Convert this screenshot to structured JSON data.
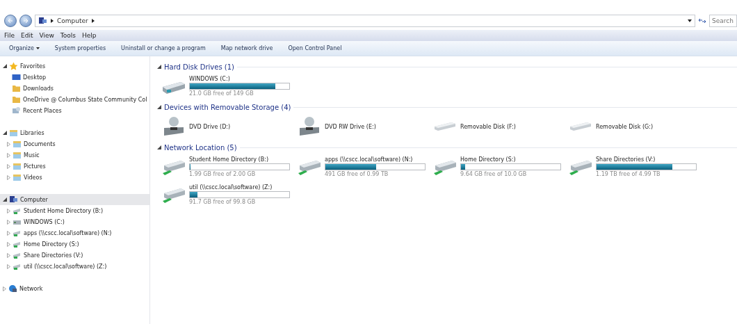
{
  "address": {
    "path": "Computer",
    "search_placeholder": "Search"
  },
  "menu": [
    "File",
    "Edit",
    "View",
    "Tools",
    "Help"
  ],
  "toolbar": [
    {
      "label": "Organize",
      "dropdown": true
    },
    {
      "label": "System properties",
      "dropdown": false
    },
    {
      "label": "Uninstall or change a program",
      "dropdown": false
    },
    {
      "label": "Map network drive",
      "dropdown": false
    },
    {
      "label": "Open Control Panel",
      "dropdown": false
    }
  ],
  "sidebar": {
    "groups": [
      {
        "label": "Favorites",
        "kind": "star",
        "expanded": true,
        "selected": false,
        "children": [
          {
            "label": "Desktop",
            "kind": "desktop"
          },
          {
            "label": "Downloads",
            "kind": "folder"
          },
          {
            "label": "OneDrive @ Columbus State Community Col",
            "kind": "folder"
          },
          {
            "label": "Recent Places",
            "kind": "recent"
          }
        ]
      },
      {
        "label": "Libraries",
        "kind": "library",
        "expanded": true,
        "selected": false,
        "children": [
          {
            "label": "Documents",
            "kind": "library",
            "expanded": false
          },
          {
            "label": "Music",
            "kind": "library",
            "expanded": false
          },
          {
            "label": "Pictures",
            "kind": "library",
            "expanded": false
          },
          {
            "label": "Videos",
            "kind": "library",
            "expanded": false
          }
        ]
      },
      {
        "label": "Computer",
        "kind": "computer",
        "expanded": true,
        "selected": true,
        "children": [
          {
            "label": "Student Home Directory (B:)",
            "kind": "network",
            "expanded": false
          },
          {
            "label": "WINDOWS (C:)",
            "kind": "hdd",
            "expanded": false
          },
          {
            "label": "apps (\\\\cscc.local\\software) (N:)",
            "kind": "network",
            "expanded": false
          },
          {
            "label": "Home Directory (S:)",
            "kind": "network",
            "expanded": false
          },
          {
            "label": "Share Directories (V:)",
            "kind": "network",
            "expanded": false
          },
          {
            "label": "util (\\\\cscc.local\\software) (Z:)",
            "kind": "network",
            "expanded": false
          }
        ]
      },
      {
        "label": "Network",
        "kind": "network-globe",
        "expanded": false,
        "selected": false
      }
    ]
  },
  "sections": [
    {
      "title": "Hard Disk Drives (1)",
      "expanded": true,
      "drives": [
        {
          "name": "WINDOWS (C:)",
          "kind": "hdd",
          "level": 0.86,
          "free": "21.0 GB free of 149 GB"
        }
      ]
    },
    {
      "title": "Devices with Removable Storage (4)",
      "expanded": true,
      "drives": [
        {
          "name": "DVD Drive (D:)",
          "kind": "dvd"
        },
        {
          "name": "DVD RW Drive (E:)",
          "kind": "dvd"
        },
        {
          "name": "Removable Disk (F:)",
          "kind": "removable"
        },
        {
          "name": "Removable Disk (G:)",
          "kind": "removable"
        }
      ]
    },
    {
      "title": "Network Location (5)",
      "expanded": true,
      "drives": [
        {
          "name": "Student Home Directory (B:)",
          "kind": "network",
          "level": 0.005,
          "free": "1.99 GB free of 2.00 GB"
        },
        {
          "name": "apps (\\\\cscc.local\\software) (N:)",
          "kind": "network",
          "level": 0.51,
          "free": "491 GB free of 0.99 TB"
        },
        {
          "name": "Home Directory (S:)",
          "kind": "network",
          "level": 0.04,
          "free": "9.64 GB free of 10.0 GB"
        },
        {
          "name": "Share Directories (V:)",
          "kind": "network",
          "level": 0.76,
          "free": "1.19 TB free of 4.99 TB"
        },
        {
          "name": "util (\\\\cscc.local\\software) (Z:)",
          "kind": "network",
          "level": 0.08,
          "free": "91.7 GB free of 99.8 GB"
        }
      ]
    }
  ]
}
